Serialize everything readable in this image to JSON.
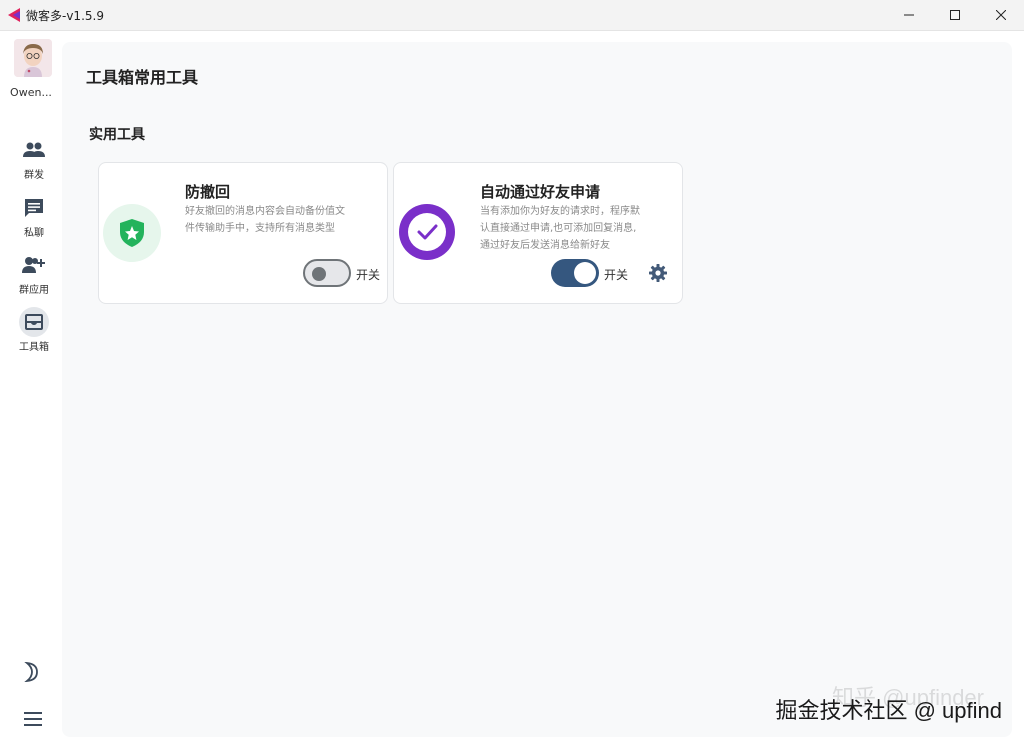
{
  "window": {
    "title": "微客多-v1.5.9",
    "controls": {
      "minimize": "—",
      "maximize": "☐",
      "close": "✕"
    }
  },
  "sidebar": {
    "username": "Owen...",
    "items": [
      {
        "label": "群发",
        "icon": "group-icon",
        "active": false
      },
      {
        "label": "私聊",
        "icon": "chat-icon",
        "active": false
      },
      {
        "label": "群应用",
        "icon": "add-user-icon",
        "active": false
      },
      {
        "label": "工具箱",
        "icon": "toolbox-icon",
        "active": true
      }
    ],
    "bottom": [
      {
        "icon": "moon-icon"
      },
      {
        "icon": "menu-icon"
      }
    ]
  },
  "main": {
    "title": "工具箱常用工具",
    "section": "实用工具",
    "cards": [
      {
        "title": "防撤回",
        "description_lines": [
          "好友撤回的消息内容会自动备份值文",
          "件传输助手中，支持所有消息类型"
        ],
        "toggle_label": "开关",
        "enabled": false,
        "icon": "shield-star-icon",
        "icon_color": "#23b35c",
        "icon_bg": "#e6f6ec"
      },
      {
        "title": "自动通过好友申请",
        "description_lines": [
          "当有添加你为好友的请求时，程序默",
          "认直接通过申请,也可添加回复消息,",
          "通过好友后发送消息给新好友"
        ],
        "toggle_label": "开关",
        "enabled": true,
        "icon": "check-circle-icon",
        "icon_color": "#7a2fc9",
        "settings_icon": "gear-icon"
      }
    ]
  },
  "colors": {
    "toggle_on": "#35577f",
    "toggle_off": "#6f7478",
    "accent_icon": "#435a78"
  },
  "watermark": {
    "text": "掘金技术社区 @ upfind",
    "faint_text": "知乎 @upfinder"
  }
}
